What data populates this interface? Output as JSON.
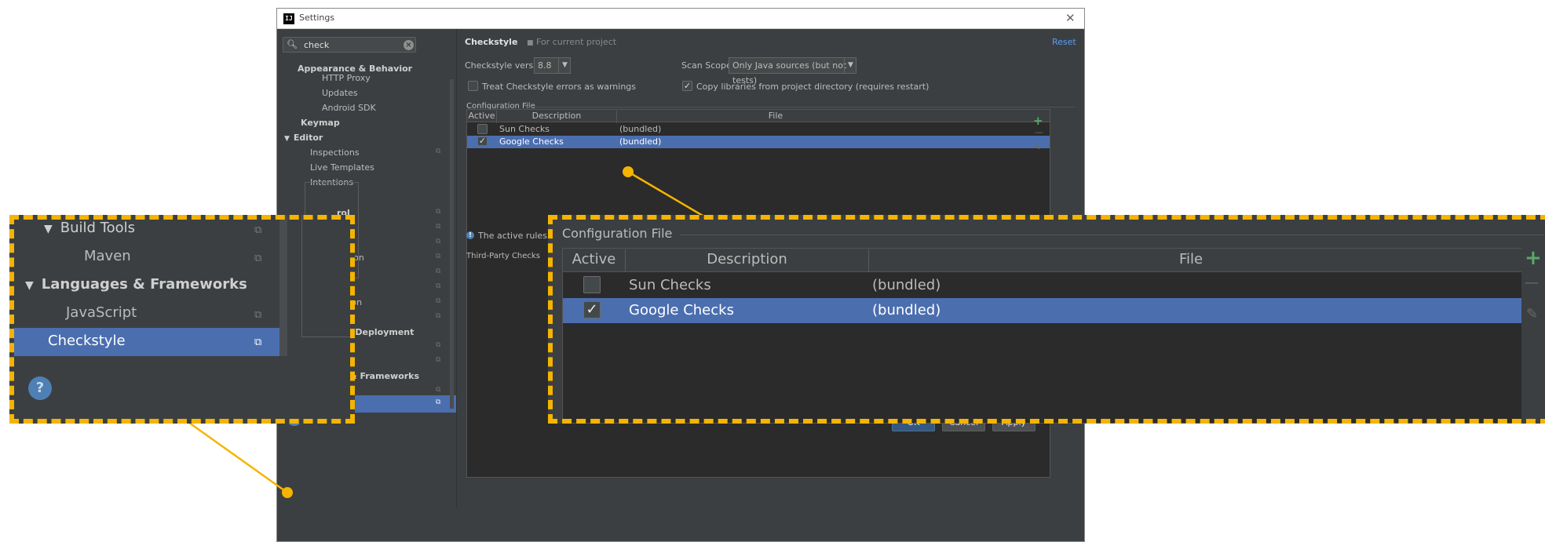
{
  "window": {
    "title": "Settings",
    "close_glyph": "✕",
    "app_icon_text": "IJ"
  },
  "search": {
    "value": "check",
    "icon": "search-icon",
    "clear_icon": "clear-icon"
  },
  "tree": {
    "appearance": "Appearance & Behavior",
    "http_proxy": "HTTP Proxy",
    "updates": "Updates",
    "android_sdk": "Android SDK",
    "keymap": "Keymap",
    "editor": "Editor",
    "inspections": "Inspections",
    "live_templates": "Live Templates",
    "intentions": "Intentions",
    "vcs_partial": "rol",
    "partial2": "d",
    "partial3": "tion",
    "partial4": "gation",
    "partial5": "tation",
    "deployment_partial": "on, Deployment",
    "maven": "Maven",
    "languages": "Languages & Frameworks",
    "javascript": "JavaScript",
    "checkstyle": "Checkstyle",
    "build_tools": "Build Tools"
  },
  "header": {
    "title": "Checkstyle",
    "scope_note": "For current project",
    "reset": "Reset"
  },
  "options": {
    "version_label": "Checkstyle version:",
    "version_value": "8.8",
    "scan_label": "Scan Scope:",
    "scan_value": "Only Java sources (but not tests)",
    "treat_label": "Treat Checkstyle errors as warnings",
    "treat_checked": false,
    "copy_label": "Copy libraries from project directory (requires restart)",
    "copy_checked": true
  },
  "config": {
    "group_label": "Configuration File",
    "columns": [
      "Active",
      "Description",
      "File"
    ],
    "rows": [
      {
        "active": false,
        "check": "",
        "description": "Sun Checks",
        "file": "(bundled)"
      },
      {
        "active": true,
        "check": "✓",
        "description": "Google Checks",
        "file": "(bundled)"
      }
    ],
    "add_glyph": "+",
    "remove_glyph": "—"
  },
  "info": {
    "text": "The active rules",
    "icon_glyph": "!"
  },
  "third_party": {
    "label": "Third-Party Checks"
  },
  "help": {
    "glyph": "?"
  },
  "buttons": {
    "ok": "OK",
    "cancel": "Cancel",
    "apply": "Apply"
  },
  "colors": {
    "accent": "#4b6eaf",
    "highlight": "#f5b400",
    "add": "#59a869"
  }
}
